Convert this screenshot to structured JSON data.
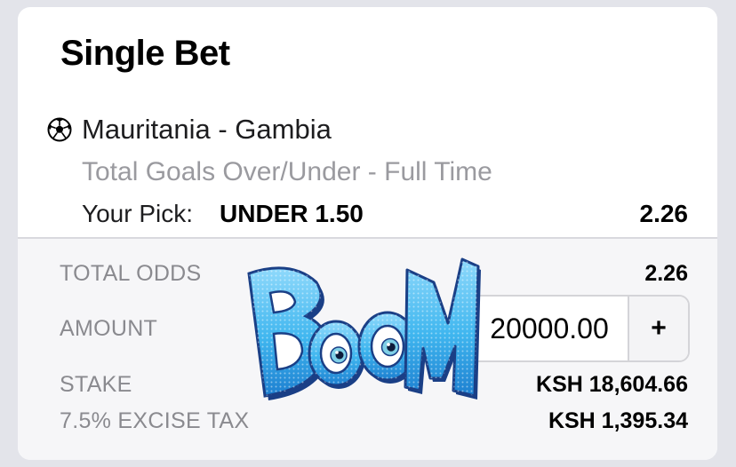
{
  "bet_slip": {
    "title": "Single Bet",
    "sport_icon": "soccer-ball-icon",
    "match": "Mauritania - Gambia",
    "market": "Total Goals Over/Under - Full Time",
    "pick_label": "Your Pick:",
    "pick_value": "UNDER 1.50",
    "pick_odds": "2.26"
  },
  "summary": {
    "total_odds_label": "TOTAL ODDS",
    "total_odds_value": "2.26",
    "amount_label": "AMOUNT",
    "amount_value": "20000.00",
    "plus_label": "+",
    "stake_label": "STAKE",
    "stake_value": "KSH 18,604.66",
    "tax_label": "7.5% EXCISE TAX",
    "tax_value": "KSH 1,395.34"
  },
  "sticker": {
    "text": "BOOM",
    "icon": "boom-sticker",
    "colors": {
      "fill": "#3fb6ef",
      "outline": "#1a3f86",
      "eye": "#7fd0e6"
    }
  },
  "colors": {
    "background": "#e3e4ea",
    "card": "#ffffff",
    "footer": "#f6f6f8",
    "muted_text": "#8a8a8f"
  }
}
